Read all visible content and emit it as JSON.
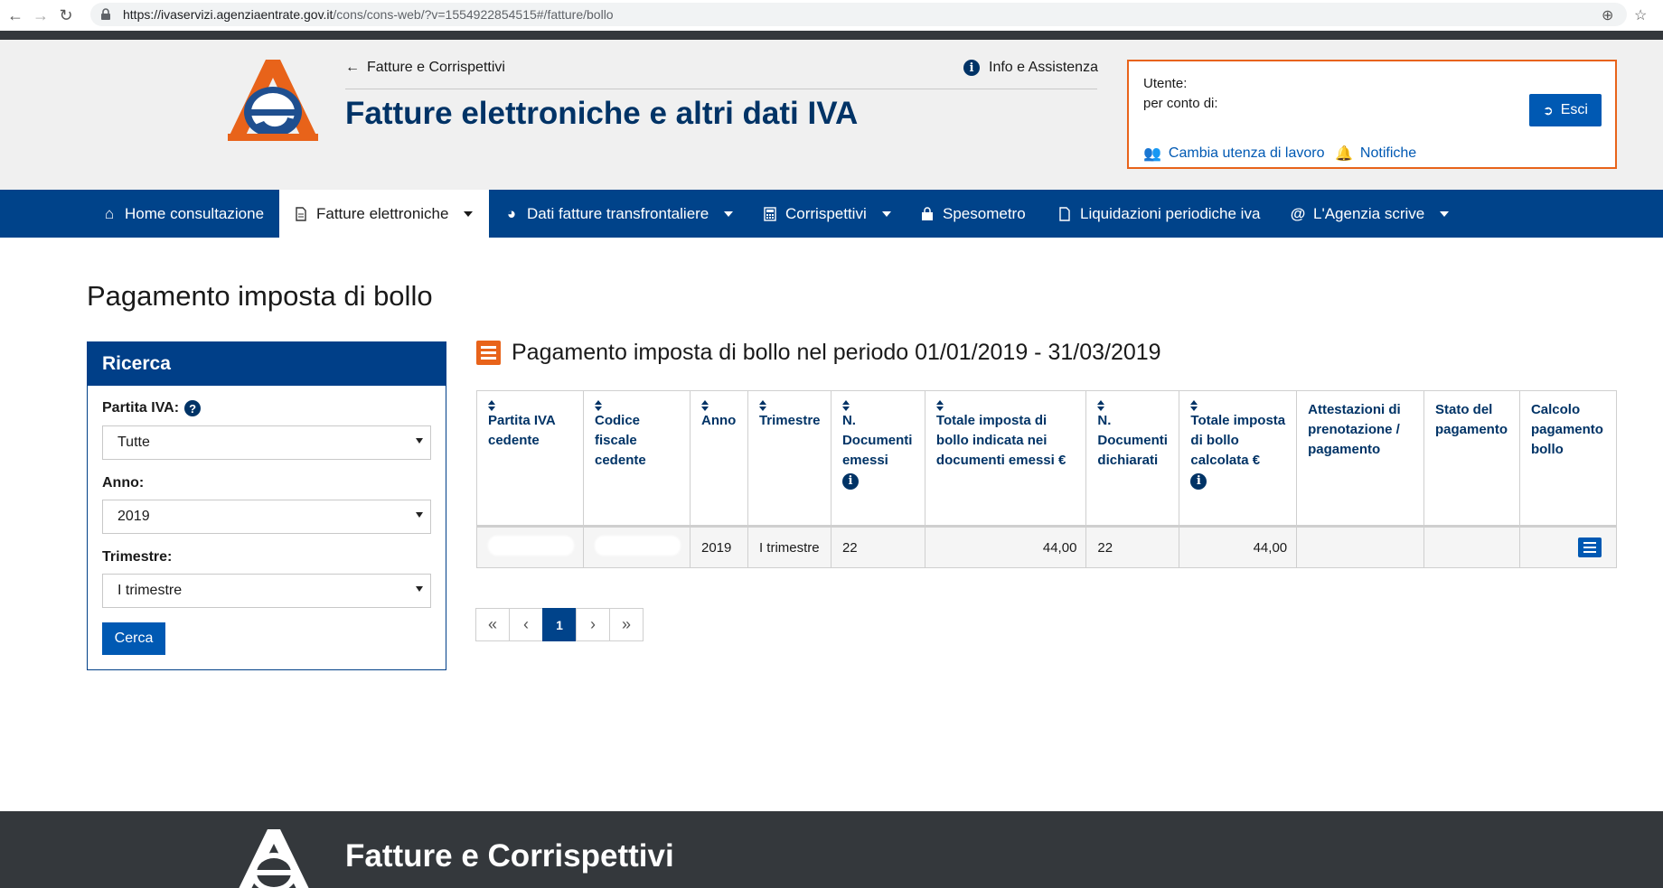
{
  "browser": {
    "url_host": "https://ivaservizi.agenziaentrate.gov.it",
    "url_path": "/cons/cons-web/?v=1554922854515#/fatture/bollo"
  },
  "header": {
    "back_link": "Fatture e Corrispettivi",
    "info_link": "Info e Assistenza",
    "title": "Fatture elettroniche e altri dati IVA",
    "user_label": "Utente:",
    "on_behalf_label": "per conto di:",
    "logout_label": "Esci",
    "change_user_label": "Cambia utenza di lavoro",
    "notifications_label": "Notifiche"
  },
  "nav": {
    "items": [
      {
        "label": "Home consultazione",
        "icon": "home-icon"
      },
      {
        "label": "Fatture elettroniche",
        "icon": "document-icon"
      },
      {
        "label": "Dati fatture transfrontaliere",
        "icon": "globe-icon"
      },
      {
        "label": "Corrispettivi",
        "icon": "calculator-icon"
      },
      {
        "label": "Spesometro",
        "icon": "shopping-bag-icon"
      },
      {
        "label": "Liquidazioni periodiche iva",
        "icon": "file-icon"
      },
      {
        "label": "L'Agenzia scrive",
        "icon": "at-icon"
      }
    ]
  },
  "page": {
    "title": "Pagamento imposta di bollo"
  },
  "search": {
    "heading": "Ricerca",
    "partita_iva_label": "Partita IVA:",
    "partita_iva_value": "Tutte",
    "anno_label": "Anno:",
    "anno_value": "2019",
    "trimestre_label": "Trimestre:",
    "trimestre_value": "I trimestre",
    "submit_label": "Cerca"
  },
  "results": {
    "heading": "Pagamento imposta di bollo nel periodo 01/01/2019 - 31/03/2019",
    "columns": [
      "Partita IVA cedente",
      "Codice fiscale cedente",
      "Anno",
      "Trimestre",
      "N. Documenti emessi",
      "Totale imposta di bollo indicata nei documenti emessi €",
      "N. Documenti dichiarati",
      "Totale imposta di bollo calcolata €",
      "Attestazioni di prenotazione / pagamento",
      "Stato del pagamento",
      "Calcolo pagamento bollo"
    ],
    "rows": [
      {
        "anno": "2019",
        "trimestre": "I trimestre",
        "n_doc_emessi": "22",
        "totale_indicata": "44,00",
        "n_doc_dichiarati": "22",
        "totale_calcolata": "44,00"
      }
    ]
  },
  "pagination": {
    "current_page": "1"
  },
  "footer": {
    "title": "Fatture e Corrispettivi"
  }
}
